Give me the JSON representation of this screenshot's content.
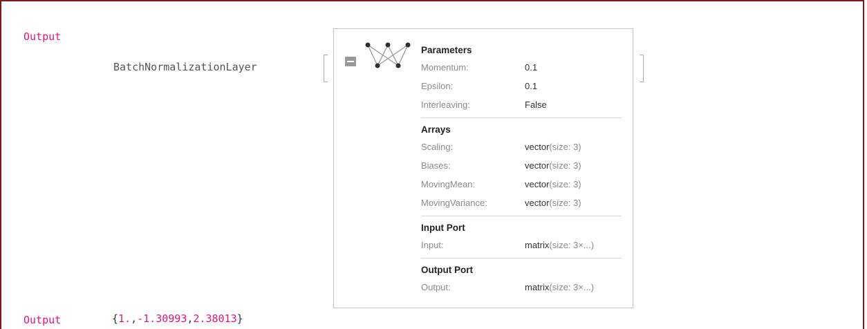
{
  "cell1": {
    "label": "Output"
  },
  "layer": {
    "head": "BatchNormalizationLayer",
    "sections": [
      {
        "title": "Parameters",
        "rows": [
          {
            "key": "Momentum:",
            "value": "0.1"
          },
          {
            "key": "Epsilon:",
            "value": "0.1"
          },
          {
            "key": "Interleaving:",
            "value": "False"
          }
        ]
      },
      {
        "title": "Arrays",
        "rows": [
          {
            "key": "Scaling:",
            "type": "vector",
            "info": "(size: 3)"
          },
          {
            "key": "Biases:",
            "type": "vector",
            "info": "(size: 3)"
          },
          {
            "key": "MovingMean:",
            "type": "vector",
            "info": "(size: 3)"
          },
          {
            "key": "MovingVariance:",
            "type": "vector",
            "info": "(size: 3)"
          }
        ]
      },
      {
        "title": "Input Port",
        "rows": [
          {
            "key": "Input:",
            "type": "matrix",
            "info": "(size: 3×...)"
          }
        ]
      },
      {
        "title": "Output Port",
        "rows": [
          {
            "key": "Output:",
            "type": "matrix",
            "info": "(size: 3×...)"
          }
        ]
      }
    ]
  },
  "cell2": {
    "label": "Output",
    "open": "{",
    "v1": "1.",
    "c1": ",",
    "v2": "-1.30993",
    "c2": ",",
    "v3": "2.38013",
    "close": "}"
  },
  "colors": {
    "label_pink": "#e0157a",
    "frame": "#7a1c1c"
  },
  "icons": {
    "collapse": "minus-square-icon",
    "network": "network-graph-icon"
  }
}
